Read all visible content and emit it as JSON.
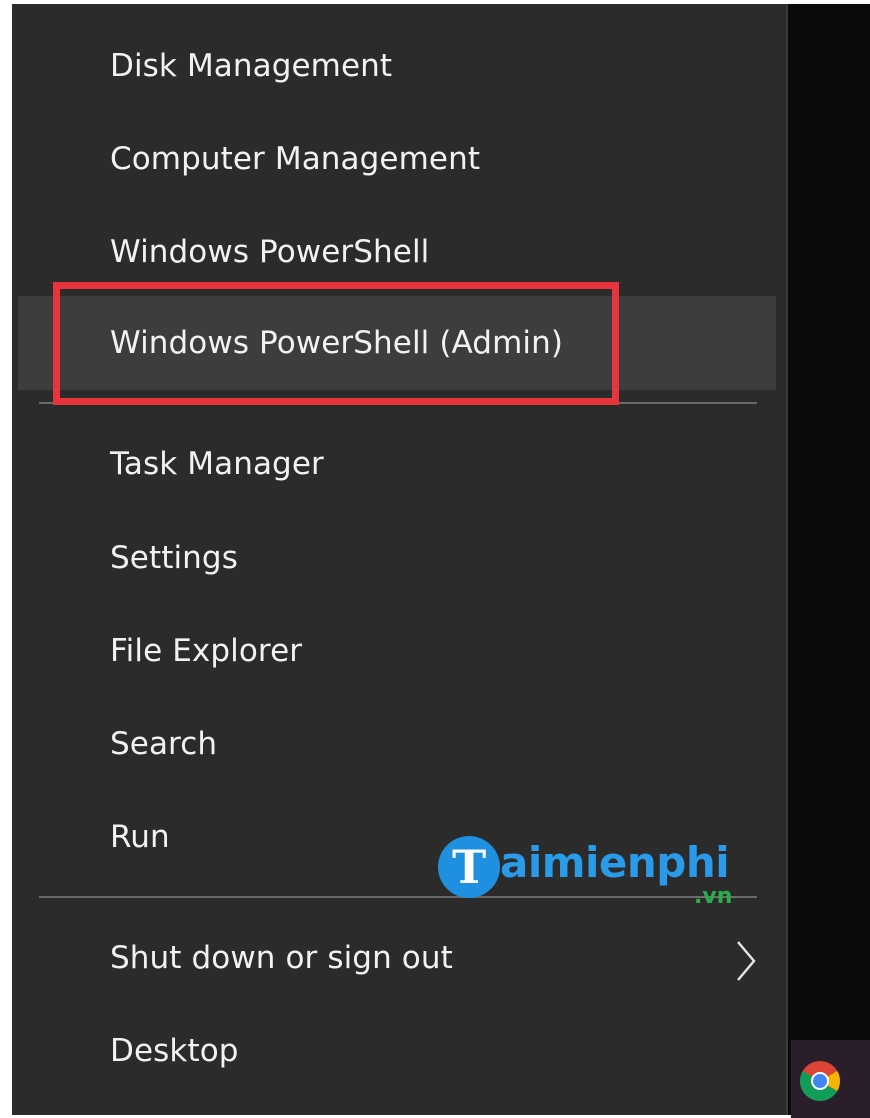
{
  "menu": {
    "items": [
      {
        "label": "Disk Management"
      },
      {
        "label": "Computer Management"
      },
      {
        "label": "Windows PowerShell"
      },
      {
        "label": "Windows PowerShell (Admin)"
      },
      {
        "label": "Task Manager"
      },
      {
        "label": "Settings"
      },
      {
        "label": "File Explorer"
      },
      {
        "label": "Search"
      },
      {
        "label": "Run"
      },
      {
        "label": "Shut down or sign out"
      },
      {
        "label": "Desktop"
      }
    ],
    "highlighted_item": "Windows PowerShell (Admin)",
    "submenu_icon": "chevron-right-icon"
  },
  "watermark": {
    "brand_letter": "T",
    "brand_text": "aimienphi",
    "tld": ".vn"
  },
  "taskbar": {
    "pinned_icon": "chrome-icon"
  },
  "colors": {
    "menu_background": "#2b2b2b",
    "menu_text": "#f2f2f2",
    "hover_background": "#3d3d3d",
    "annotation_box": "#e8343d",
    "watermark_blue": "#2a9be8",
    "watermark_green": "#27b04a"
  }
}
